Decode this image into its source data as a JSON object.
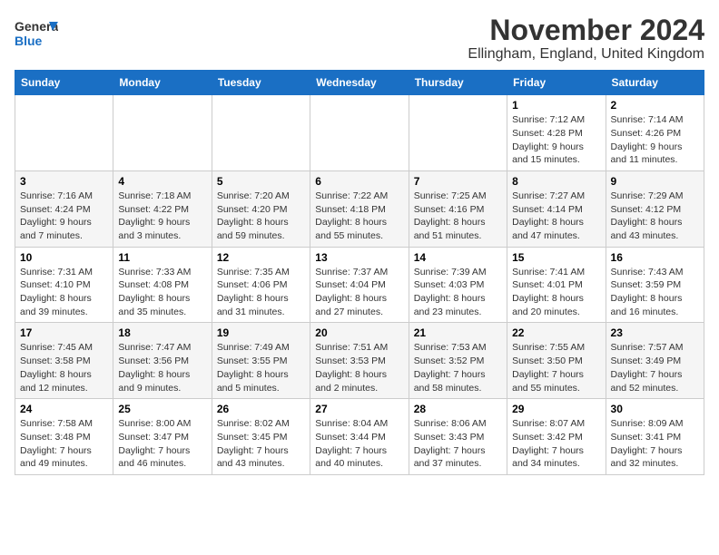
{
  "logo": {
    "line1": "General",
    "line2": "Blue"
  },
  "title": "November 2024",
  "subtitle": "Ellingham, England, United Kingdom",
  "days_of_week": [
    "Sunday",
    "Monday",
    "Tuesday",
    "Wednesday",
    "Thursday",
    "Friday",
    "Saturday"
  ],
  "weeks": [
    [
      {
        "day": "",
        "info": ""
      },
      {
        "day": "",
        "info": ""
      },
      {
        "day": "",
        "info": ""
      },
      {
        "day": "",
        "info": ""
      },
      {
        "day": "",
        "info": ""
      },
      {
        "day": "1",
        "info": "Sunrise: 7:12 AM\nSunset: 4:28 PM\nDaylight: 9 hours and 15 minutes."
      },
      {
        "day": "2",
        "info": "Sunrise: 7:14 AM\nSunset: 4:26 PM\nDaylight: 9 hours and 11 minutes."
      }
    ],
    [
      {
        "day": "3",
        "info": "Sunrise: 7:16 AM\nSunset: 4:24 PM\nDaylight: 9 hours and 7 minutes."
      },
      {
        "day": "4",
        "info": "Sunrise: 7:18 AM\nSunset: 4:22 PM\nDaylight: 9 hours and 3 minutes."
      },
      {
        "day": "5",
        "info": "Sunrise: 7:20 AM\nSunset: 4:20 PM\nDaylight: 8 hours and 59 minutes."
      },
      {
        "day": "6",
        "info": "Sunrise: 7:22 AM\nSunset: 4:18 PM\nDaylight: 8 hours and 55 minutes."
      },
      {
        "day": "7",
        "info": "Sunrise: 7:25 AM\nSunset: 4:16 PM\nDaylight: 8 hours and 51 minutes."
      },
      {
        "day": "8",
        "info": "Sunrise: 7:27 AM\nSunset: 4:14 PM\nDaylight: 8 hours and 47 minutes."
      },
      {
        "day": "9",
        "info": "Sunrise: 7:29 AM\nSunset: 4:12 PM\nDaylight: 8 hours and 43 minutes."
      }
    ],
    [
      {
        "day": "10",
        "info": "Sunrise: 7:31 AM\nSunset: 4:10 PM\nDaylight: 8 hours and 39 minutes."
      },
      {
        "day": "11",
        "info": "Sunrise: 7:33 AM\nSunset: 4:08 PM\nDaylight: 8 hours and 35 minutes."
      },
      {
        "day": "12",
        "info": "Sunrise: 7:35 AM\nSunset: 4:06 PM\nDaylight: 8 hours and 31 minutes."
      },
      {
        "day": "13",
        "info": "Sunrise: 7:37 AM\nSunset: 4:04 PM\nDaylight: 8 hours and 27 minutes."
      },
      {
        "day": "14",
        "info": "Sunrise: 7:39 AM\nSunset: 4:03 PM\nDaylight: 8 hours and 23 minutes."
      },
      {
        "day": "15",
        "info": "Sunrise: 7:41 AM\nSunset: 4:01 PM\nDaylight: 8 hours and 20 minutes."
      },
      {
        "day": "16",
        "info": "Sunrise: 7:43 AM\nSunset: 3:59 PM\nDaylight: 8 hours and 16 minutes."
      }
    ],
    [
      {
        "day": "17",
        "info": "Sunrise: 7:45 AM\nSunset: 3:58 PM\nDaylight: 8 hours and 12 minutes."
      },
      {
        "day": "18",
        "info": "Sunrise: 7:47 AM\nSunset: 3:56 PM\nDaylight: 8 hours and 9 minutes."
      },
      {
        "day": "19",
        "info": "Sunrise: 7:49 AM\nSunset: 3:55 PM\nDaylight: 8 hours and 5 minutes."
      },
      {
        "day": "20",
        "info": "Sunrise: 7:51 AM\nSunset: 3:53 PM\nDaylight: 8 hours and 2 minutes."
      },
      {
        "day": "21",
        "info": "Sunrise: 7:53 AM\nSunset: 3:52 PM\nDaylight: 7 hours and 58 minutes."
      },
      {
        "day": "22",
        "info": "Sunrise: 7:55 AM\nSunset: 3:50 PM\nDaylight: 7 hours and 55 minutes."
      },
      {
        "day": "23",
        "info": "Sunrise: 7:57 AM\nSunset: 3:49 PM\nDaylight: 7 hours and 52 minutes."
      }
    ],
    [
      {
        "day": "24",
        "info": "Sunrise: 7:58 AM\nSunset: 3:48 PM\nDaylight: 7 hours and 49 minutes."
      },
      {
        "day": "25",
        "info": "Sunrise: 8:00 AM\nSunset: 3:47 PM\nDaylight: 7 hours and 46 minutes."
      },
      {
        "day": "26",
        "info": "Sunrise: 8:02 AM\nSunset: 3:45 PM\nDaylight: 7 hours and 43 minutes."
      },
      {
        "day": "27",
        "info": "Sunrise: 8:04 AM\nSunset: 3:44 PM\nDaylight: 7 hours and 40 minutes."
      },
      {
        "day": "28",
        "info": "Sunrise: 8:06 AM\nSunset: 3:43 PM\nDaylight: 7 hours and 37 minutes."
      },
      {
        "day": "29",
        "info": "Sunrise: 8:07 AM\nSunset: 3:42 PM\nDaylight: 7 hours and 34 minutes."
      },
      {
        "day": "30",
        "info": "Sunrise: 8:09 AM\nSunset: 3:41 PM\nDaylight: 7 hours and 32 minutes."
      }
    ]
  ]
}
